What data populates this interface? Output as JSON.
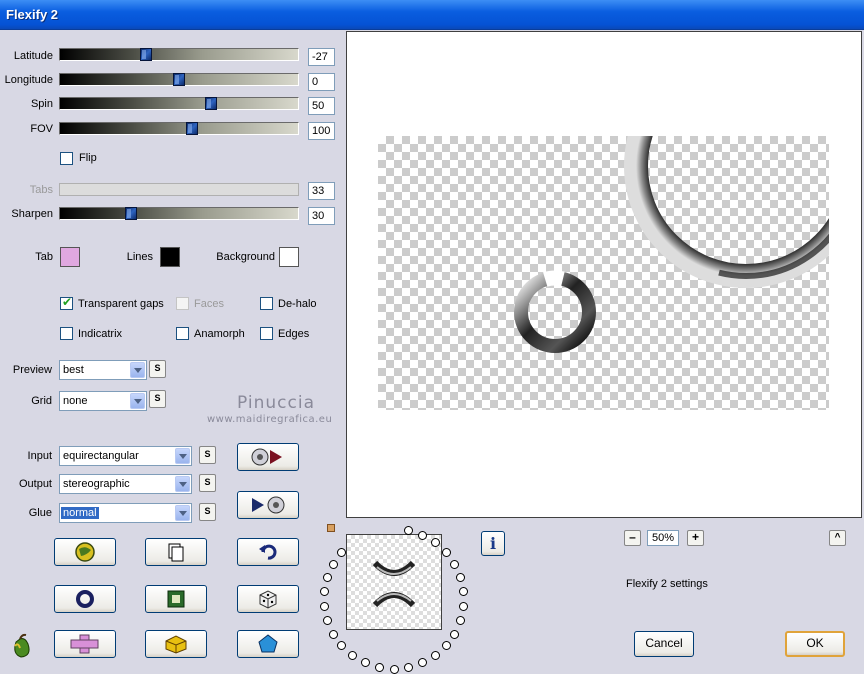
{
  "window": {
    "title": "Flexify 2"
  },
  "sliders": {
    "latitude": {
      "label": "Latitude",
      "value": "-27",
      "fraction": 0.36
    },
    "longitude": {
      "label": "Longitude",
      "value": "0",
      "fraction": 0.5
    },
    "spin": {
      "label": "Spin",
      "value": "50",
      "fraction": 0.635
    },
    "fov": {
      "label": "FOV",
      "value": "100",
      "fraction": 0.555
    },
    "tabs": {
      "label": "Tabs",
      "value": "33"
    },
    "sharpen": {
      "label": "Sharpen",
      "value": "30",
      "fraction": 0.3
    }
  },
  "flip": {
    "label": "Flip",
    "checked": false
  },
  "colors": {
    "tab": {
      "label": "Tab",
      "color": "#e0a8e0"
    },
    "lines": {
      "label": "Lines",
      "color": "#000000"
    },
    "background": {
      "label": "Background",
      "color": "#ffffff"
    }
  },
  "options": {
    "transparent_gaps": {
      "label": "Transparent gaps",
      "checked": true
    },
    "faces": {
      "label": "Faces",
      "checked": false
    },
    "de_halo": {
      "label": "De-halo",
      "checked": false
    },
    "indicatrix": {
      "label": "Indicatrix",
      "checked": false
    },
    "anamorph": {
      "label": "Anamorph",
      "checked": false
    },
    "edges": {
      "label": "Edges",
      "checked": false
    }
  },
  "preview": {
    "label": "Preview",
    "value": "best"
  },
  "grid": {
    "label": "Grid",
    "value": "none"
  },
  "input": {
    "label": "Input",
    "value": "equirectangular"
  },
  "output": {
    "label": "Output",
    "value": "stereographic"
  },
  "glue": {
    "label": "Glue",
    "value": "normal"
  },
  "s_label": "S",
  "watermark": {
    "name": "Pinuccia",
    "url": "www.maidiregrafica.eu"
  },
  "zoom": {
    "value": "50%",
    "minus": "–",
    "plus": "+"
  },
  "info_label": "i",
  "collapse_label": "^",
  "status_text": "Flexify 2 settings",
  "buttons": {
    "cancel": "Cancel",
    "ok": "OK"
  }
}
